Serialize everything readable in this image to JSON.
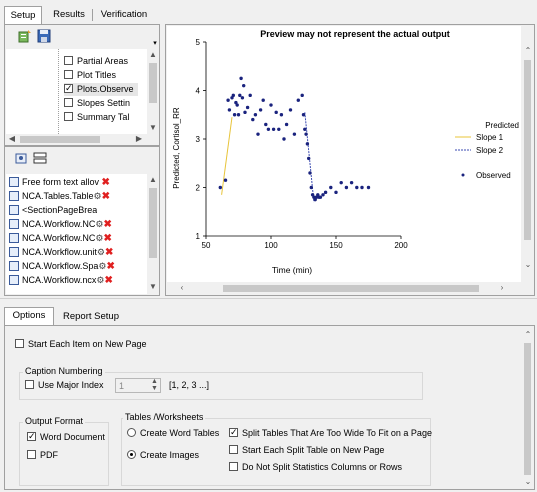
{
  "top_tabs": [
    "Setup",
    "Results",
    "Verification"
  ],
  "tree_items": [
    {
      "label": "Partial Areas",
      "checked": false
    },
    {
      "label": "Plot Titles",
      "checked": false
    },
    {
      "label": "Plots.Observe",
      "checked": true
    },
    {
      "label": "Slopes Settin",
      "checked": false
    },
    {
      "label": "Summary Tal",
      "checked": false
    }
  ],
  "item_list": [
    "Free form text allov",
    "NCA.Tables.Table",
    "<SectionPageBrea",
    "NCA.Workflow.NC",
    "NCA.Workflow.NC",
    "NCA.Workflow.unit",
    "NCA.Workflow.Spa",
    "NCA.Workflow.ncx"
  ],
  "preview": {
    "title": "Preview may not represent the actual output",
    "xlabel": "Time (min)",
    "ylabel": "Predicted, Cortisol_RR"
  },
  "chart_data": {
    "type": "scatter",
    "title": "Preview may not represent the actual output",
    "xlabel": "Time (min)",
    "ylabel": "Predicted, Cortisol_RR",
    "xlim": [
      50,
      200
    ],
    "ylim": [
      1,
      5
    ],
    "xticks": [
      50,
      100,
      150,
      200
    ],
    "yticks": [
      1,
      2,
      3,
      4,
      5
    ],
    "legend": [
      "Predicted",
      "Slope 1",
      "Slope 2",
      "Observed"
    ],
    "legend_placement": "right",
    "colors": {
      "slope1": "#e8c43a",
      "slope2": "#3a4ab0",
      "observed": "#1a237e"
    },
    "slope1": {
      "x": [
        62,
        70
      ],
      "y": [
        1.85,
        3.45
      ]
    },
    "slope2": {
      "x": [
        126,
        133
      ],
      "y": [
        3.55,
        1.7
      ]
    },
    "series": [
      {
        "name": "Observed",
        "x": [
          61,
          65,
          67,
          68,
          70,
          71,
          72,
          73,
          74,
          75,
          76,
          77,
          78,
          79,
          80,
          82,
          84,
          86,
          88,
          90,
          92,
          94,
          96,
          98,
          100,
          102,
          104,
          106,
          108,
          110,
          112,
          115,
          118,
          121,
          124,
          125,
          126,
          127,
          128,
          129,
          130,
          131,
          132,
          133,
          134,
          135,
          136,
          137,
          138,
          140,
          142,
          146,
          150,
          154,
          158,
          162,
          166,
          170,
          175
        ],
        "y": [
          2.0,
          2.15,
          3.8,
          3.6,
          3.85,
          3.9,
          3.5,
          3.75,
          3.7,
          3.5,
          3.9,
          4.25,
          3.85,
          4.1,
          3.55,
          3.65,
          3.9,
          3.4,
          3.5,
          3.1,
          3.6,
          3.8,
          3.3,
          3.2,
          3.7,
          3.2,
          3.55,
          3.2,
          3.5,
          3.0,
          3.3,
          3.6,
          3.1,
          3.8,
          3.9,
          3.5,
          3.2,
          3.1,
          2.9,
          2.6,
          2.3,
          2.0,
          1.85,
          1.8,
          1.75,
          1.8,
          1.85,
          1.8,
          1.8,
          1.85,
          1.9,
          2.0,
          1.9,
          2.1,
          2.0,
          2.1,
          2.0,
          2.0,
          2.0
        ]
      }
    ]
  },
  "bottom_tabs": [
    "Options",
    "Report Setup"
  ],
  "options": {
    "start_each_item": {
      "label": "Start Each Item on New Page",
      "checked": false
    },
    "caption_numbering": {
      "title": "Caption Numbering",
      "use_major_index": {
        "label": "Use Major Index",
        "checked": false
      },
      "index_value": "1",
      "index_hint": "[1, 2, 3 ...]"
    },
    "output_format": {
      "title": "Output Format",
      "word": {
        "label": "Word Document",
        "checked": true
      },
      "pdf": {
        "label": "PDF",
        "checked": false
      }
    },
    "tables_worksheets": {
      "title": "Tables /Worksheets",
      "create_word_tables": {
        "label": "Create Word Tables",
        "selected": false
      },
      "create_images": {
        "label": "Create Images",
        "selected": true
      },
      "split_tables": {
        "label": "Split Tables That Are Too Wide To Fit on a Page",
        "checked": true
      },
      "start_each_split": {
        "label": "Start Each Split Table on New Page",
        "checked": false
      },
      "do_not_split": {
        "label": "Do Not Split Statistics Columns or Rows",
        "checked": false
      }
    }
  }
}
